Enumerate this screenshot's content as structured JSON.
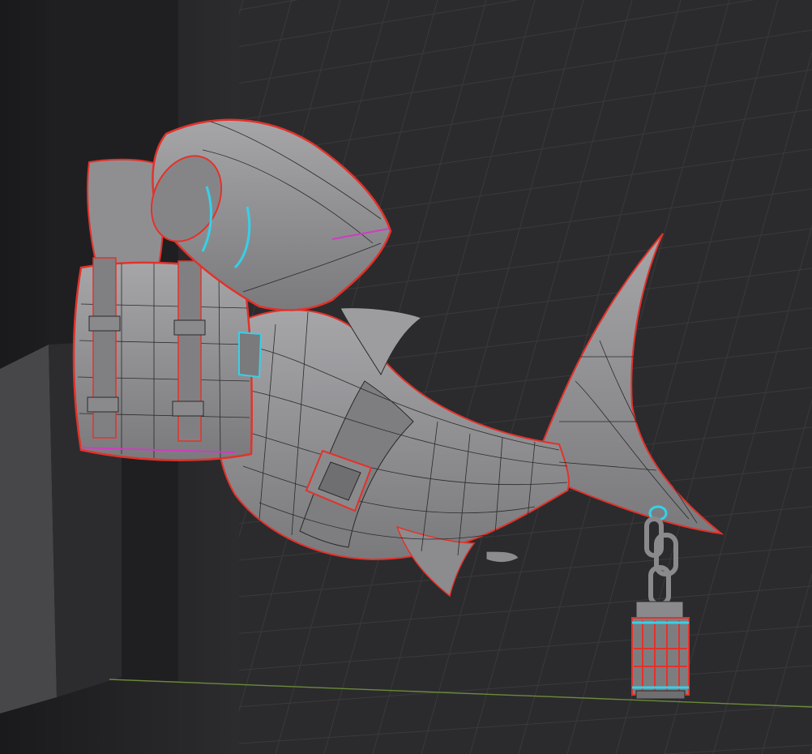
{
  "viewport": {
    "kind": "3d-modeling-viewport",
    "mode": "edit-mesh-wireframe-overlay",
    "colors": {
      "background": "#2b2b2d",
      "grid_line": "#3a3a3d",
      "grid_axis_x": "#6a8a3a",
      "mesh_surface": "#8f8f92",
      "mesh_shadow": "#6a6a6d",
      "wire_edge": "#2a2a2a",
      "seam_edge": "#e3322a",
      "selected_edge": "#36d0e8",
      "sharp_edge": "#d03cc0",
      "wall_dark": "#1c1c1e",
      "wall_mid": "#3b3b3d"
    },
    "objects": [
      {
        "name": "shark-body",
        "semantic": "shark"
      },
      {
        "name": "backpack",
        "semantic": "backpack"
      },
      {
        "name": "bedroll",
        "semantic": "rolled-bag"
      },
      {
        "name": "lantern",
        "semantic": "lantern"
      },
      {
        "name": "chain",
        "semantic": "chain"
      },
      {
        "name": "belt-buckle",
        "semantic": "buckle"
      },
      {
        "name": "wall-block",
        "semantic": "wall"
      }
    ]
  }
}
